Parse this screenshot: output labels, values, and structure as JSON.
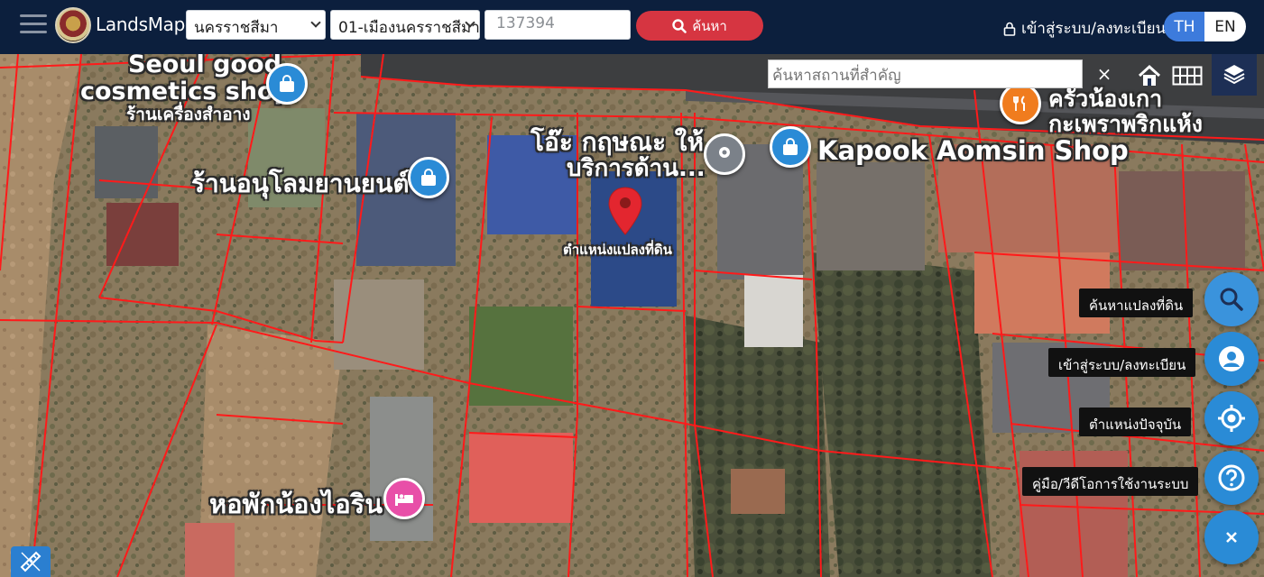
{
  "header": {
    "app_name": "LandsMaps",
    "province": "นครราชสีมา",
    "district": "01-เมืองนครราชสีมา",
    "parcel_number": "137394",
    "search_label": "ค้นหา",
    "login_label": "เข้าสู่ระบบ/ลงทะเบียน",
    "lang_th": "TH",
    "lang_en": "EN",
    "active_lang": "TH"
  },
  "map": {
    "landmark_placeholder": "ค้นหาสถานที่สำคัญ",
    "clear_symbol": "×",
    "parcel_marker_label": "ตำแหน่งแปลงที่ดิน",
    "labels": {
      "seoul": "Seoul good",
      "cosmetics": "cosmetics shop",
      "cosmetics_th": "ร้านเครื่องสำอาง",
      "car_shop": "ร้านอนุโลมยานยนต์",
      "okrit1": "โอ๊ะ กฤษณะ ให้",
      "okrit2": "บริการด้าน...",
      "kapook": "Kapook Aomsin Shop",
      "restaurant1": "ครัวน้องเกา",
      "restaurant2": "กะเพราพริกแห้ง",
      "dorm": "หอพักน้องไอริน"
    }
  },
  "side_actions": [
    {
      "label": "ค้นหาแปลงที่ดิน",
      "icon": "search-icon"
    },
    {
      "label": "เข้าสู่ระบบ/ลงทะเบียน",
      "icon": "user-icon"
    },
    {
      "label": "ตำแหน่งปัจจุบัน",
      "icon": "crosshair-icon"
    },
    {
      "label": "คู่มือ/วีดีโอการใช้งานระบบ",
      "icon": "help-icon"
    }
  ],
  "colors": {
    "topbar": "#0c1f3d",
    "accent_blue": "#2a8bd6",
    "search_red": "#d63541",
    "parcel_line": "#ff1a1a"
  }
}
